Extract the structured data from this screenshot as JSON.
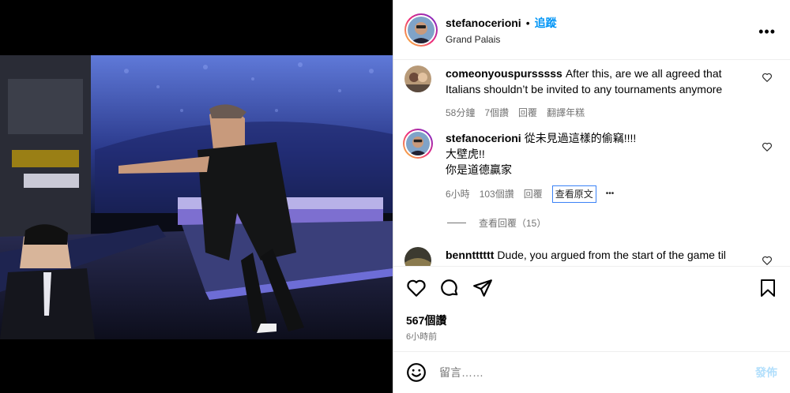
{
  "post": {
    "username": "stefanocerioni",
    "dot": "•",
    "follow_label": "追蹤",
    "location": "Grand Palais",
    "likes": "567個讚",
    "time": "6小時前"
  },
  "comments": [
    {
      "username": "comeonyouspursssss",
      "text": "After this, are we all agreed that Italians shouldn’t be invited to any tournaments anymore",
      "age": "58分鐘",
      "likes": "7個讚",
      "reply": "回覆",
      "translate": "翻譯年糕"
    },
    {
      "username": "stefanocerioni",
      "line1": "從未見過這樣的偷竊!!!!",
      "line2": "大壁虎!!",
      "line3": "你是道德贏家",
      "age": "6小時",
      "likes": "103個讚",
      "reply": "回覆",
      "translate": "查看原文",
      "more": "•••"
    },
    {
      "username": "benntttttt",
      "text": "Dude, you argued from the start of the game til"
    }
  ],
  "view_replies": "查看回覆（15）",
  "add_comment": {
    "placeholder": "留言……",
    "post_label": "發佈"
  },
  "colors": {
    "accent": "#0095f6",
    "post_disabled": "#b2dffc",
    "muted": "#737373"
  },
  "icons": {
    "more": "more-icon",
    "heart": "heart-icon",
    "comment": "comment-icon",
    "share": "share-icon",
    "save": "bookmark-icon",
    "emoji": "emoji-icon"
  }
}
